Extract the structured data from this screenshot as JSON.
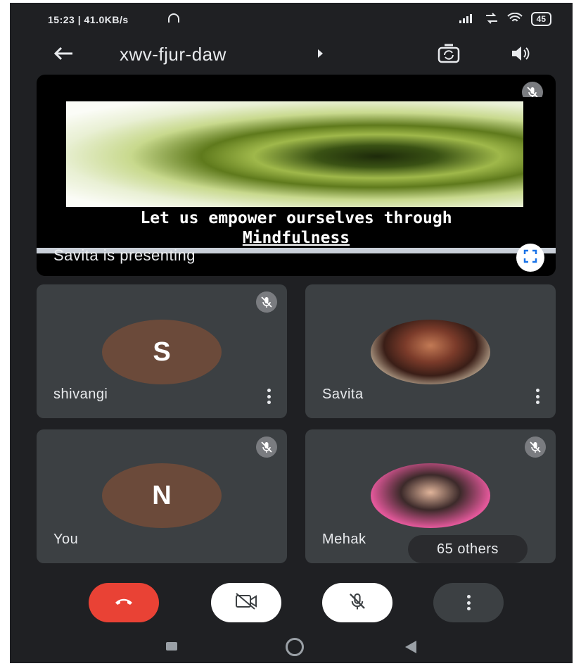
{
  "status_bar": {
    "time": "15:23 | 41.0KB/s",
    "battery": "45"
  },
  "header": {
    "meeting_code": "xwv-fjur-daw",
    "icons": [
      "back-arrow-icon",
      "switch-camera-icon",
      "speaker-icon"
    ]
  },
  "presentation": {
    "caption_line1": "Let us empower ourselves through",
    "caption_line2": "Mindfulness",
    "presenting_label": "Savita is presenting"
  },
  "participants": [
    {
      "name": "shivangi",
      "initial": "S",
      "avatar": "letter"
    },
    {
      "name": "Savita",
      "initial": "",
      "avatar": "photo"
    },
    {
      "name": "You",
      "initial": "N",
      "avatar": "letter"
    },
    {
      "name": "Mehak",
      "initial": "",
      "avatar": "photo"
    }
  ],
  "others_chip": "65 others",
  "colors": {
    "background": "#1f2023",
    "tile": "#3c4043",
    "end_call": "#e94235",
    "avatar_letter": "#6b4a3a"
  }
}
